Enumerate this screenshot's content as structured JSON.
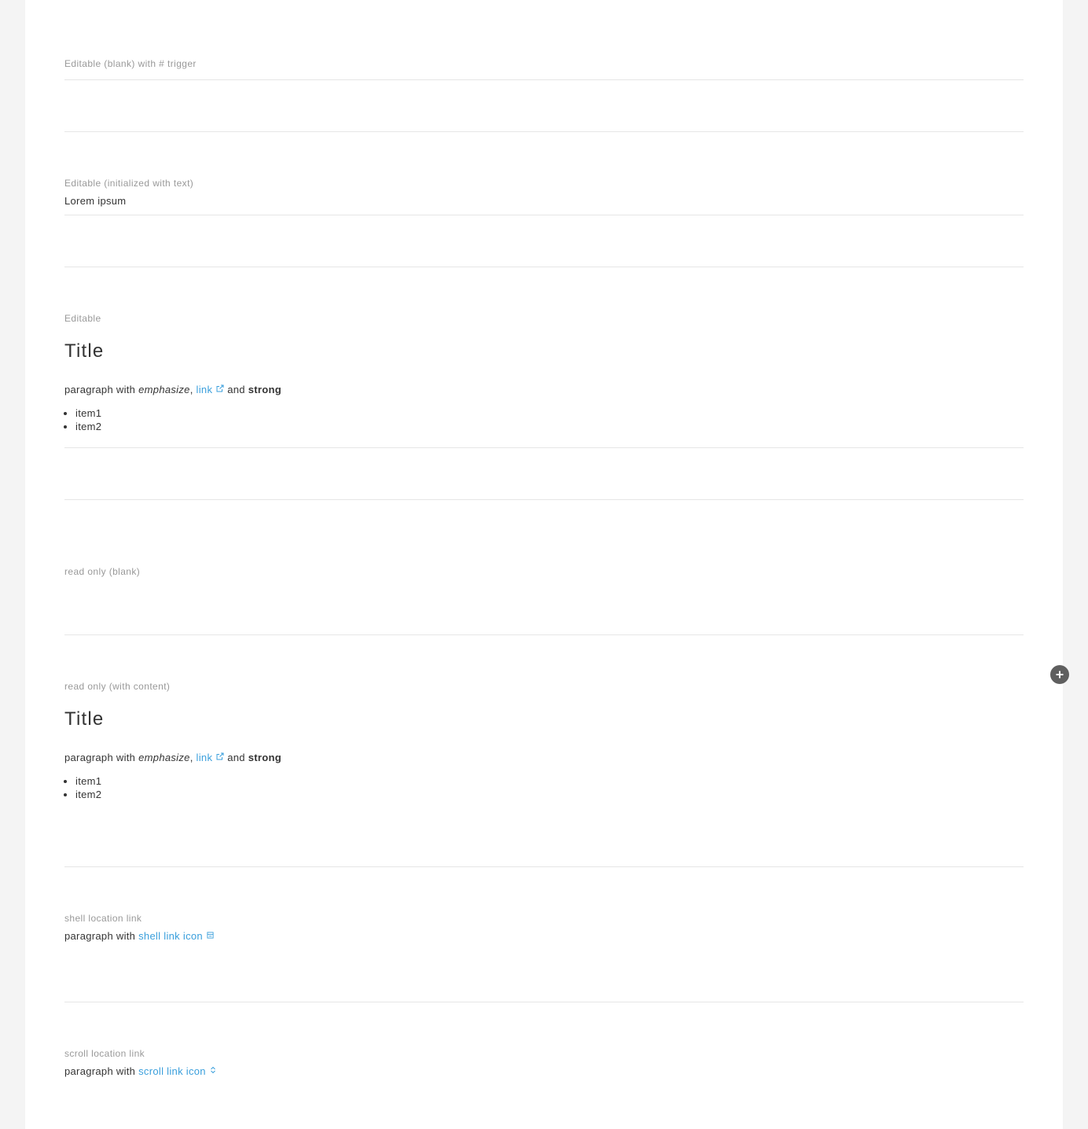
{
  "sections": {
    "hash_trigger": {
      "label": "Editable (blank) with # trigger"
    },
    "initialized": {
      "label": "Editable (initialized with text)",
      "value": "Lorem ipsum"
    },
    "editable": {
      "label": "Editable",
      "title": "Title",
      "para_prefix": "paragraph with",
      "emphasis": "emphasize",
      "comma": ",",
      "link": "link",
      "and": "and",
      "strong": "strong",
      "items": [
        "item1",
        "item2"
      ]
    },
    "readonly_blank": {
      "label": "read only (blank)"
    },
    "readonly_content": {
      "label": "read only (with content)",
      "title": "Title",
      "para_prefix": "paragraph with",
      "emphasis": "emphasize",
      "comma": ",",
      "link": "link",
      "and": "and",
      "strong": "strong",
      "items": [
        "item1",
        "item2"
      ]
    },
    "shell_link": {
      "label": "shell location link",
      "para_prefix": "paragraph with",
      "link": "shell link icon",
      "icon": "shell-link-icon"
    },
    "scroll_link": {
      "label": "scroll location link",
      "para_prefix": "paragraph with",
      "link": "scroll link icon",
      "icon": "scroll-link-icon"
    }
  },
  "add_button": {
    "icon": "plus-icon"
  },
  "colors": {
    "link": "#3a9fdc",
    "label": "#999999",
    "divider": "#e6e6e6",
    "background": "#f4f4f4"
  }
}
